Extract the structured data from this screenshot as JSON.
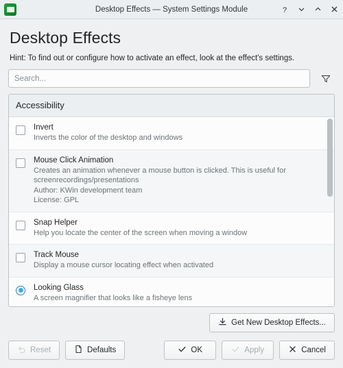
{
  "titlebar": {
    "icon": "kwin-effects-icon",
    "title": "Desktop Effects — System Settings Module",
    "help_label": "?",
    "minimize_label": "minimize",
    "maximize_label": "maximize",
    "close_label": "close"
  },
  "page": {
    "title": "Desktop Effects",
    "hint": "Hint: To find out or configure how to activate an effect, look at the effect's settings."
  },
  "search": {
    "value": "",
    "placeholder": "Search...",
    "filter_icon": "filter-icon"
  },
  "list": {
    "group": "Accessibility",
    "effects": [
      {
        "name": "Invert",
        "desc": "Inverts the color of the desktop and windows",
        "control": "checkbox",
        "checked": false,
        "author": "",
        "license": ""
      },
      {
        "name": "Mouse Click Animation",
        "desc": "Creates an animation whenever a mouse button is clicked. This is useful for screenrecordings/presentations",
        "control": "checkbox",
        "checked": false,
        "author": "Author: KWin development team",
        "license": "License: GPL"
      },
      {
        "name": "Snap Helper",
        "desc": "Help you locate the center of the screen when moving a window",
        "control": "checkbox",
        "checked": false,
        "author": "",
        "license": ""
      },
      {
        "name": "Track Mouse",
        "desc": "Display a mouse cursor locating effect when activated",
        "control": "checkbox",
        "checked": false,
        "author": "",
        "license": ""
      },
      {
        "name": "Looking Glass",
        "desc": "A screen magnifier that looks like a fisheye lens",
        "control": "radio",
        "checked": true,
        "author": "",
        "license": ""
      }
    ]
  },
  "actions": {
    "get_new": "Get New Desktop Effects...",
    "get_new_icon": "download-icon",
    "reset": "Reset",
    "reset_icon": "undo-icon",
    "defaults": "Defaults",
    "defaults_icon": "document-icon",
    "ok": "OK",
    "ok_icon": "check-icon",
    "apply": "Apply",
    "apply_icon": "check-icon",
    "cancel": "Cancel",
    "cancel_icon": "close-icon"
  },
  "colors": {
    "accent": "#3daee9",
    "window_bg": "#eff0f1",
    "view_bg": "#fcfcfc",
    "text": "#232629",
    "subtext": "#6e7376",
    "disabled": "#a7acb0"
  }
}
